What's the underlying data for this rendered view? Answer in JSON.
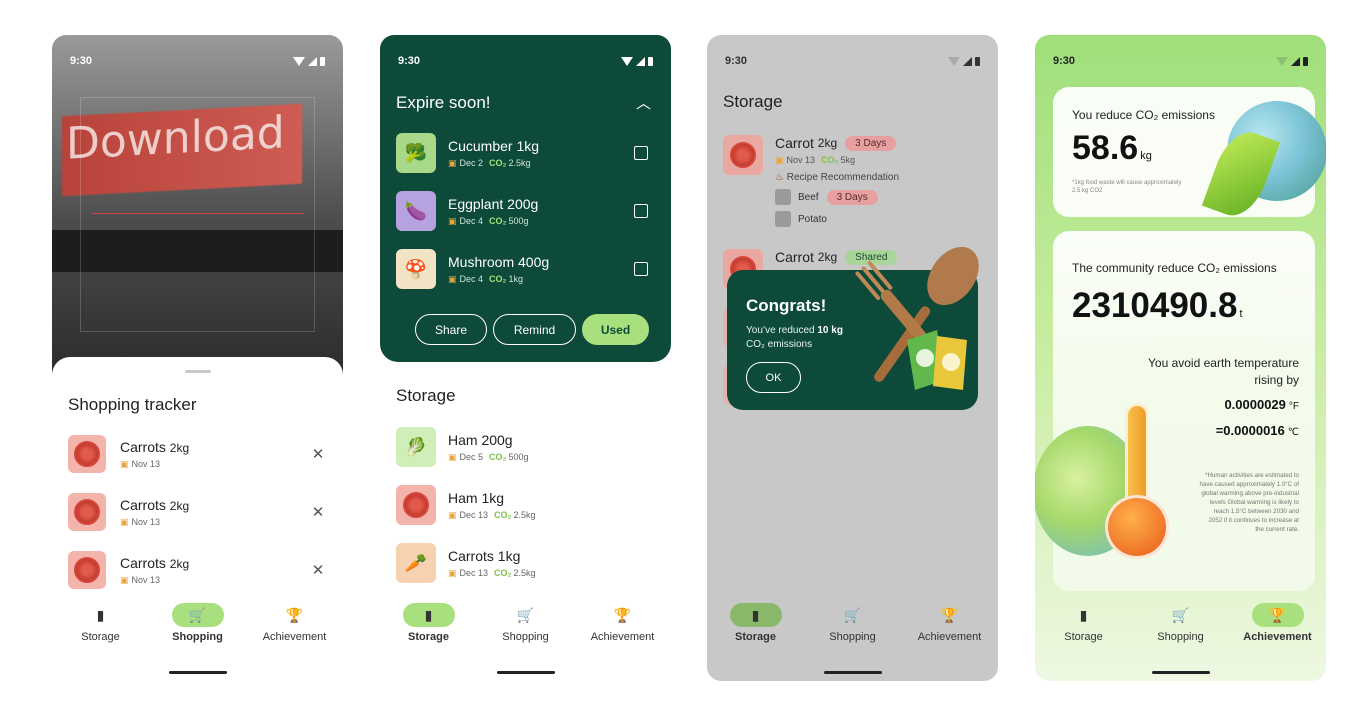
{
  "status_time": "9:30",
  "nav": {
    "storage": "Storage",
    "shopping": "Shopping",
    "achievement": "Achievement",
    "storage_icon": "fridge-icon",
    "shopping_icon": "cart-icon",
    "achievement_icon": "trophy-icon"
  },
  "screen1": {
    "camera_text": "Download",
    "sheet_title": "Shopping tracker",
    "items": [
      {
        "name": "Carrots",
        "qty": "2kg",
        "date": "Nov 13"
      },
      {
        "name": "Carrots",
        "qty": "2kg",
        "date": "Nov 13"
      },
      {
        "name": "Carrots",
        "qty": "2kg",
        "date": "Nov 13"
      }
    ],
    "active_nav": "shopping"
  },
  "screen2": {
    "expire_title": "Expire soon!",
    "co2_label": "CO₂",
    "expire_items": [
      {
        "name": "Cucumber 1kg",
        "date": "Dec 2",
        "co2": "2.5kg",
        "icon": "broccoli-icon",
        "bg": "#a8d88a"
      },
      {
        "name": "Eggplant 200g",
        "date": "Dec 4",
        "co2": "500g",
        "icon": "eggplant-icon",
        "bg": "#b7a2e0"
      },
      {
        "name": "Mushroom 400g",
        "date": "Dec 4",
        "co2": "1kg",
        "icon": "mushroom-icon",
        "bg": "#f2e3c4"
      }
    ],
    "buttons": {
      "share": "Share",
      "remind": "Remind",
      "used": "Used"
    },
    "storage_title": "Storage",
    "storage_items": [
      {
        "name": "Ham 200g",
        "date": "Dec 5",
        "co2": "500g",
        "icon": "leek-icon",
        "bg": "#cfeeb8"
      },
      {
        "name": "Ham 1kg",
        "date": "Dec 13",
        "co2": "2.5kg",
        "icon": "tomato-icon",
        "bg": "#f3b4ac"
      },
      {
        "name": "Carrots 1kg",
        "date": "Dec 13",
        "co2": "2.5kg",
        "icon": "carrot-icon",
        "bg": "#f6d2b0"
      }
    ],
    "active_nav": "storage"
  },
  "screen3": {
    "title": "Storage",
    "item1": {
      "name": "Carrot",
      "qty": "2kg",
      "tag": "3 Days",
      "date": "Nov 13",
      "co2_label": "CO₂",
      "co2": "5kg"
    },
    "recipe_label": "Recipe Recommendation",
    "recipe_items": [
      {
        "name": "Beef",
        "tag": "3 Days"
      },
      {
        "name": "Potato",
        "tag": ""
      }
    ],
    "item2": {
      "name": "Carrot",
      "qty": "2kg",
      "tag": "Shared"
    },
    "congrats": {
      "title": "Congrats!",
      "text_before": "You’ve reduced ",
      "amount": "10 kg",
      "text_after": "CO₂ emissions",
      "ok": "OK"
    },
    "active_nav": "storage"
  },
  "screen4": {
    "card1": {
      "label": "You reduce CO₂ emissions",
      "value": "58.6",
      "unit": "kg",
      "note": "*1kg food waste will cause approximately 2.5 kg CO2"
    },
    "card2": {
      "label": "The community reduce CO₂ emissions",
      "value": "2310490.8",
      "unit": "t",
      "avoid": "You avoid earth temperature rising by",
      "temp_f": "0.0000029",
      "temp_f_unit": "°F",
      "temp_c": "=0.0000016",
      "temp_c_unit": "℃",
      "note": "*Human activities are estimated to have caused approximately 1.0°C of global warming above pre-industrial levels Global warming is likely to reach 1.5°C between 2030 and 2052 if it continues to increase at the current rate."
    },
    "active_nav": "achievement"
  }
}
